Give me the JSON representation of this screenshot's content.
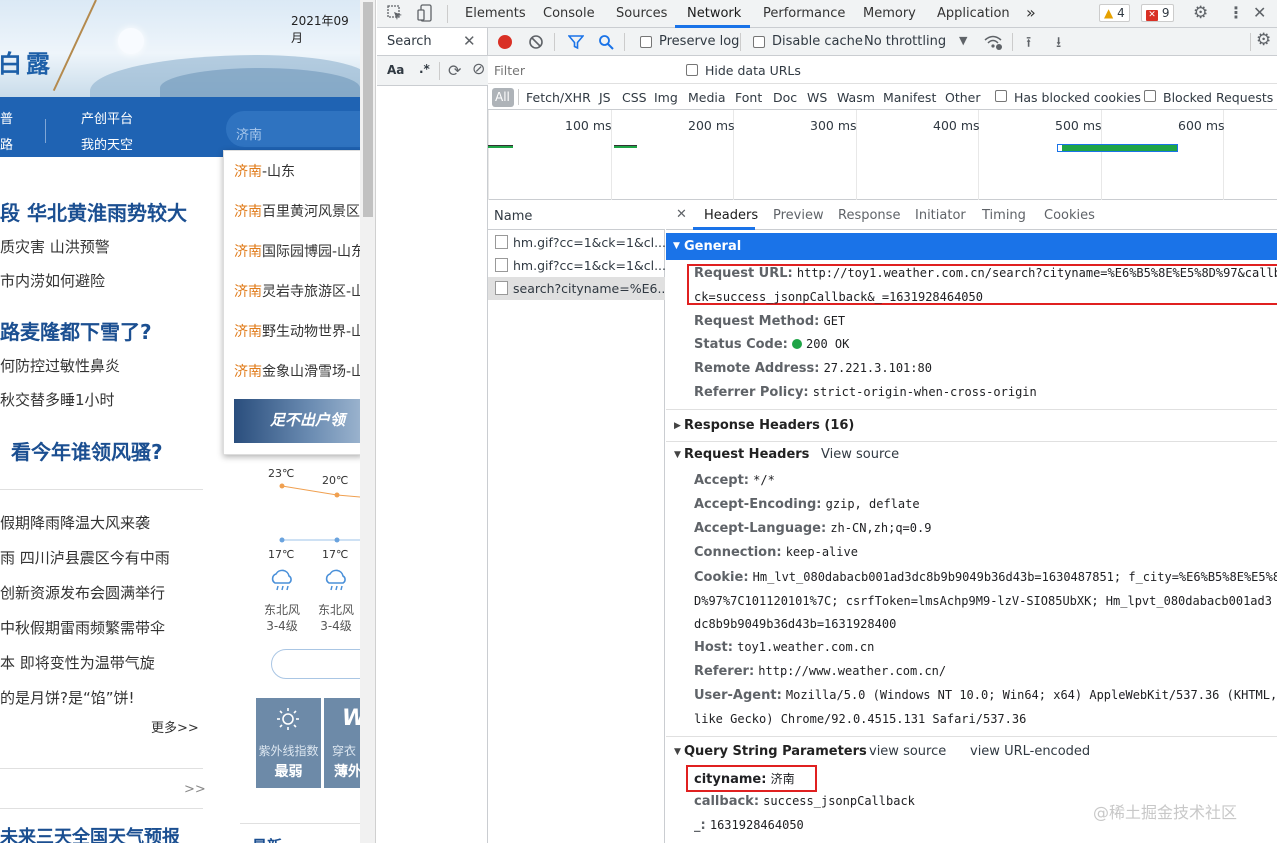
{
  "webpage": {
    "banner_title": "白露",
    "date": "2021年09月",
    "nav": {
      "link1": "普",
      "link2": "路",
      "link3": "产创平台",
      "link4": "我的天空"
    },
    "search_value": "济南",
    "suggestions": [
      {
        "hl": "济南",
        "rest": "-山东"
      },
      {
        "hl": "济南",
        "rest": "百里黄河风景区"
      },
      {
        "hl": "济南",
        "rest": "国际园博园-山东"
      },
      {
        "hl": "济南",
        "rest": "灵岩寺旅游区-山东"
      },
      {
        "hl": "济南",
        "rest": "野生动物世界-山东"
      },
      {
        "hl": "济南",
        "rest": "金象山滑雪场-山东"
      }
    ],
    "suggest_banner": "足不出户领",
    "headlines": [
      "段 华北黄淮雨势较大",
      "路麦隆都下雪了?",
      "看今年谁领风骚?",
      "未来三天全国天气预报"
    ],
    "news": [
      "质灾害 山洪预警",
      "市内涝如何避险",
      "何防控过敏性鼻炎",
      "秋交替多睡1小时",
      "假期降雨降温大风来袭",
      "雨  四川泸县震区今有中雨",
      "创新资源发布会圆满举行",
      "中秋假期雷雨频繁需带伞",
      "本 即将变性为温带气旋",
      "的是月饼?是“馅”饼!"
    ],
    "more": "更多>>",
    "more2": ">>",
    "weather": {
      "high": [
        "23℃",
        "20℃"
      ],
      "low": [
        "17℃",
        "17℃"
      ],
      "wind": [
        "东北风",
        "东北风"
      ],
      "level": [
        "3-4级",
        "3-4级"
      ]
    },
    "tiles": [
      {
        "label": "紫外线指数",
        "value": "最弱"
      },
      {
        "label": "穿衣",
        "value": "薄外"
      }
    ],
    "bottom_text": "最新..."
  },
  "devtools": {
    "tabs": [
      "Elements",
      "Console",
      "Sources",
      "Network",
      "Performance",
      "Memory",
      "Application"
    ],
    "more_tabs": "»",
    "warnings": "4",
    "errors": "9",
    "search_title": "Search",
    "search_opts": {
      "case": "Aa",
      "regex": ".*"
    },
    "toolbar": {
      "preserve_log": "Preserve log",
      "disable_cache": "Disable cache",
      "throttling": "No throttling"
    },
    "filter_placeholder": "Filter",
    "hide_data_urls": "Hide data URLs",
    "types": [
      "All",
      "Fetch/XHR",
      "JS",
      "CSS",
      "Img",
      "Media",
      "Font",
      "Doc",
      "WS",
      "Wasm",
      "Manifest",
      "Other"
    ],
    "has_blocked_cookies": "Has blocked cookies",
    "blocked_requests": "Blocked Requests",
    "timeline_labels": [
      "100 ms",
      "200 ms",
      "300 ms",
      "400 ms",
      "500 ms",
      "600 ms"
    ],
    "colors": {
      "accent": "#1a73e8",
      "highlight_box": "#e02020",
      "status_ok": "#1ea446",
      "bar_wait": "#1ea446",
      "bar_download": "#1a73e8"
    },
    "name_header": "Name",
    "requests": [
      "hm.gif?cc=1&ck=1&cl...",
      "hm.gif?cc=1&ck=1&cl...",
      "search?cityname=%E6..."
    ],
    "panel_tabs": [
      "Headers",
      "Preview",
      "Response",
      "Initiator",
      "Timing",
      "Cookies"
    ],
    "general": {
      "title": "General",
      "request_url_key": "Request URL:",
      "request_url_1": "http://toy1.weather.com.cn/search?cityname=%E6%B5%8E%E5%8D%97&callba",
      "request_url_2": "ck=success_jsonpCallback&_=1631928464050",
      "method_key": "Request Method:",
      "method": "GET",
      "status_key": "Status Code:",
      "status": "200 OK",
      "remote_key": "Remote Address:",
      "remote": "27.221.3.101:80",
      "referrer_key": "Referrer Policy:",
      "referrer": "strict-origin-when-cross-origin"
    },
    "response_headers": "Response Headers (16)",
    "request_headers": {
      "title": "Request Headers",
      "view_source": "View source",
      "accept_key": "Accept:",
      "accept": "*/*",
      "encoding_key": "Accept-Encoding:",
      "encoding": "gzip, deflate",
      "language_key": "Accept-Language:",
      "language": "zh-CN,zh;q=0.9",
      "connection_key": "Connection:",
      "connection": "keep-alive",
      "cookie_key": "Cookie:",
      "cookie_1": "Hm_lvt_080dabacb001ad3dc8b9b9049b36d43b=1630487851; f_city=%E6%B5%8E%E5%8",
      "cookie_2": "D%97%7C101120101%7C; csrfToken=lmsAchp9M9-lzV-SIO85UbXK; Hm_lpvt_080dabacb001ad3",
      "cookie_3": "dc8b9b9049b36d43b=1631928400",
      "host_key": "Host:",
      "host": "toy1.weather.com.cn",
      "referer_key": "Referer:",
      "referer": "http://www.weather.com.cn/",
      "ua_key": "User-Agent:",
      "ua_1": "Mozilla/5.0 (Windows NT 10.0; Win64; x64) AppleWebKit/537.36 (KHTML,",
      "ua_2": "like Gecko) Chrome/92.0.4515.131 Safari/537.36"
    },
    "query": {
      "title": "Query String Parameters",
      "view_source": "view source",
      "view_encoded": "view URL-encoded",
      "cityname_key": "cityname:",
      "cityname": "济南",
      "callback_key": "callback:",
      "callback": "success_jsonpCallback",
      "ts_key": "_:",
      "ts": "1631928464050"
    }
  },
  "watermark": "@稀土掘金技术社区"
}
